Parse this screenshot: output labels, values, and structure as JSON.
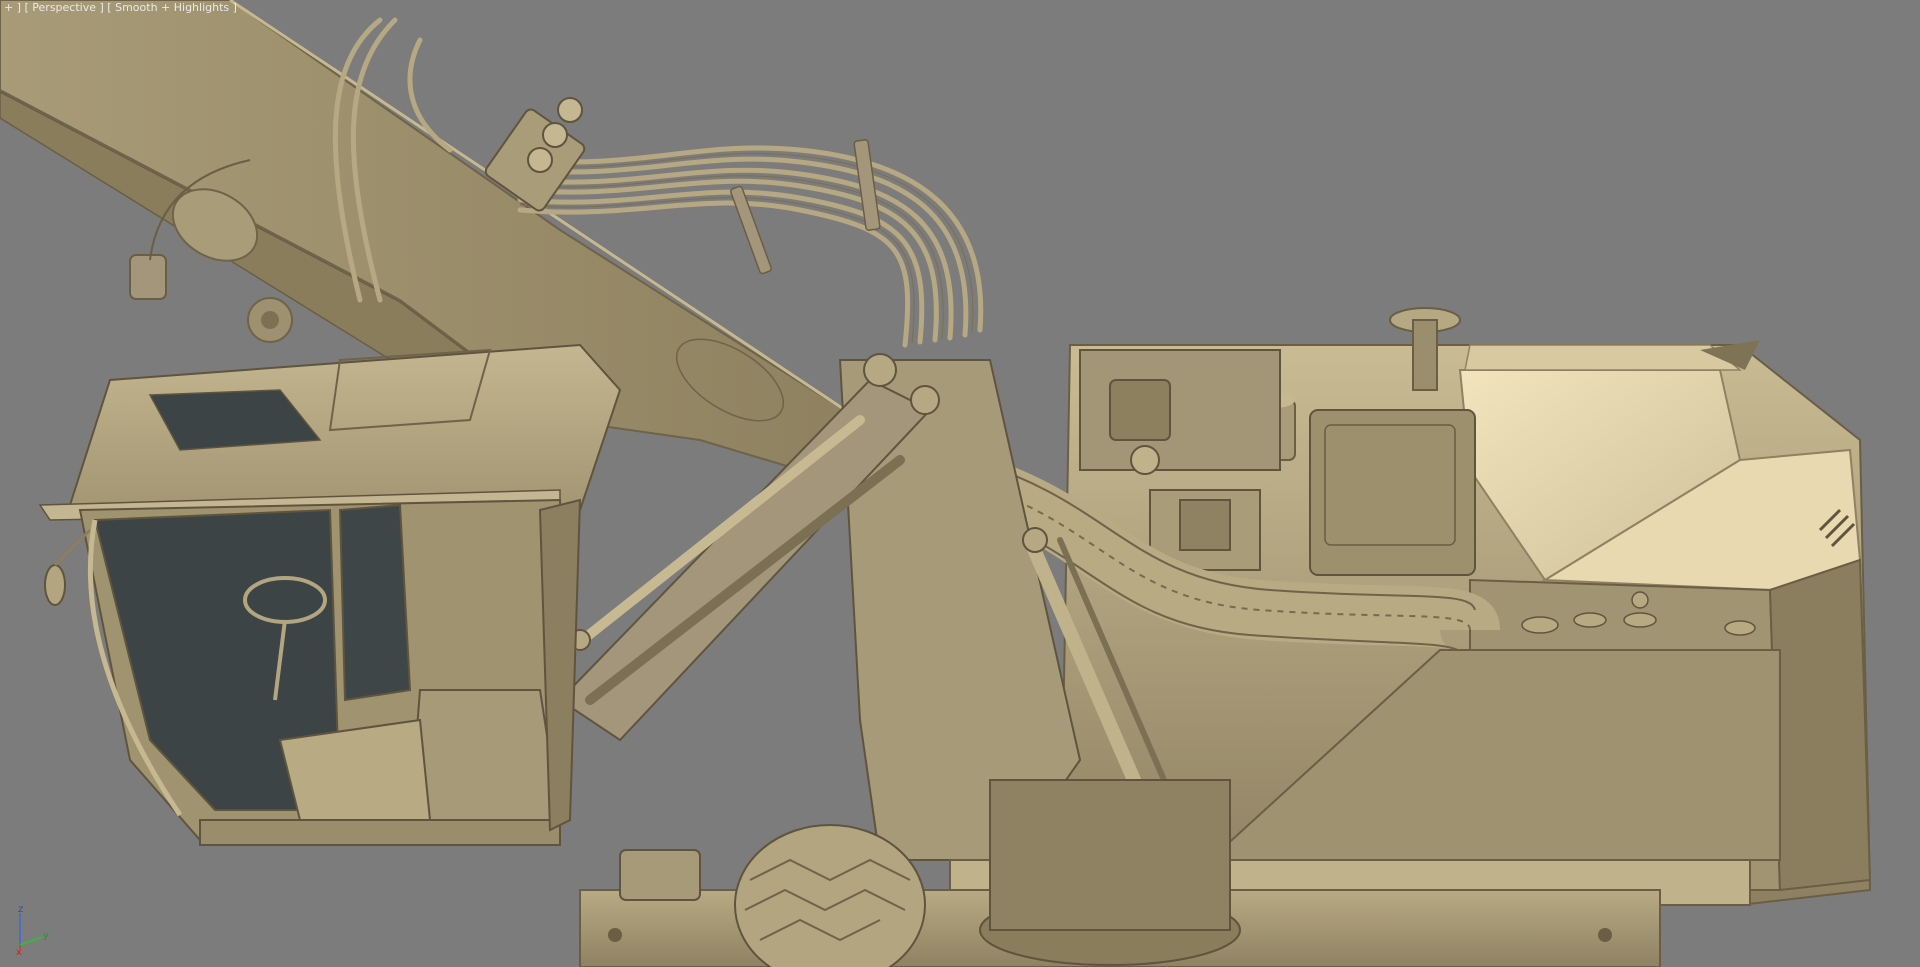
{
  "viewport": {
    "label_parts": [
      "+ ] [ ",
      "Perspective",
      " ] [ ",
      "Smooth + Highlights",
      " ]"
    ],
    "colors": {
      "background": "#7c7c7c",
      "model_base": "#b3a57f",
      "model_light": "#d9cba3",
      "model_dark": "#7a6d4f",
      "cab_glass": "#3c4446"
    },
    "axis_gizmo": {
      "z": "z",
      "y": "y",
      "x": "x"
    }
  }
}
